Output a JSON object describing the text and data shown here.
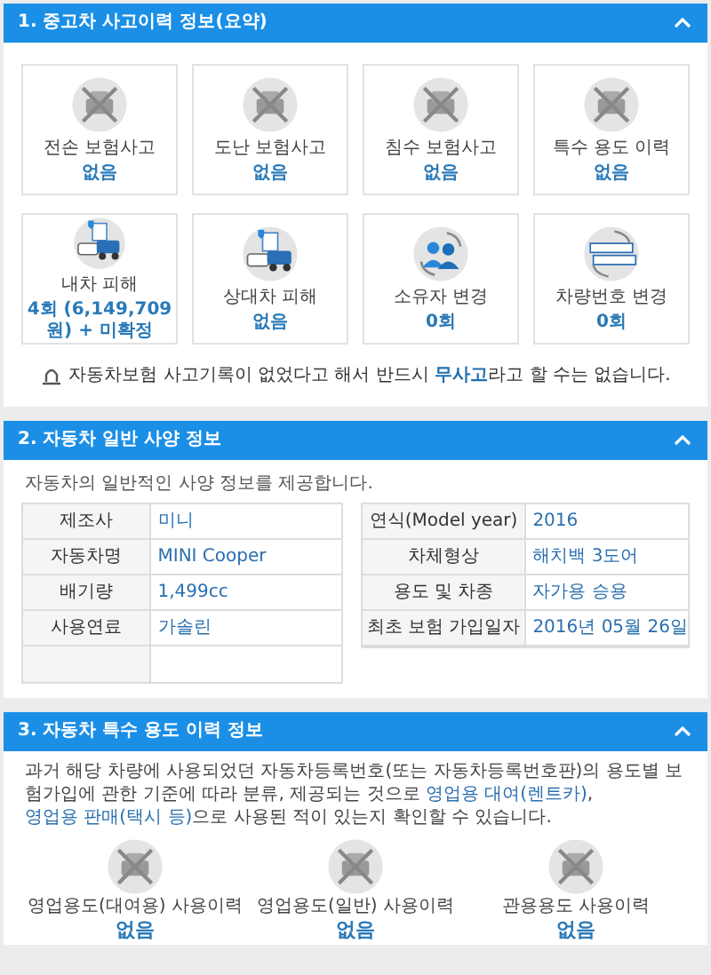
{
  "sections": [
    {
      "title": "1. 중고차 사고이력 정보(요약)",
      "expanded": true
    },
    {
      "title": "2. 자동차 일반 사양 정보",
      "expanded": true
    },
    {
      "title": "3. 자동차 특수 용도 이력 정보",
      "expanded": true
    }
  ],
  "summary_cards": [
    {
      "label": "전손 보험사고",
      "value": "없음",
      "kind": "crossed"
    },
    {
      "label": "도난 보험사고",
      "value": "없음",
      "kind": "crossed"
    },
    {
      "label": "침수 보험사고",
      "value": "없음",
      "kind": "crossed"
    },
    {
      "label": "특수 용도 이력",
      "value": "없음",
      "kind": "crossed"
    },
    {
      "label": "내차 피해",
      "value": "4회 (6,149,709 원) + 미확정",
      "kind": "damage"
    },
    {
      "label": "상대차 피해",
      "value": "없음",
      "kind": "damage"
    },
    {
      "label": "소유자 변경",
      "value": "0회",
      "kind": "owner"
    },
    {
      "label": "차량번호 변경",
      "value": "0회",
      "kind": "plate"
    }
  ],
  "summary_notice": "자동차보험 사고기록이 없었다고 해서 반드시 **무사고**라고 할 수는 없습니다.",
  "spec_intro": "자동차의 일반적인 사양 정보를 제공합니다.",
  "spec_left": [
    {
      "label": "제조사",
      "value": "미니"
    },
    {
      "label": "자동차명",
      "value": "MINI Cooper"
    },
    {
      "label": "배기량",
      "value": "1,499cc"
    },
    {
      "label": "사용연료",
      "value": "가솔린"
    }
  ],
  "spec_right": [
    {
      "label": "연식(Model year)",
      "value": "2016"
    },
    {
      "label": "차체형상",
      "value": "해치백 3도어"
    },
    {
      "label": "용도 및 차종",
      "value": "자가용 승용"
    },
    {
      "label": "최초 보험 가입일자",
      "value": "2016년 05월 26일"
    }
  ],
  "special_intro": {
    "text": "과거 해당 차량에 사용되었던 자동차등록번호(또는 자동차등록번호판)의 용도별 보험가입에 관한 기준에 따라 분류, 제공되는 것으로",
    "links": [
      "영업용 대여(렌트카)",
      "영업용 판매(택시 등)"
    ],
    "separator": ",",
    "tail": "으로 사용된 적이 있는지 확인할 수 있습니다."
  },
  "special_items": [
    {
      "label": "영업용도(대여용) 사용이력",
      "value": "없음"
    },
    {
      "label": "영업용도(일반) 사용이력",
      "value": "없음"
    },
    {
      "label": "관용용도 사용이력",
      "value": "없음"
    }
  ]
}
